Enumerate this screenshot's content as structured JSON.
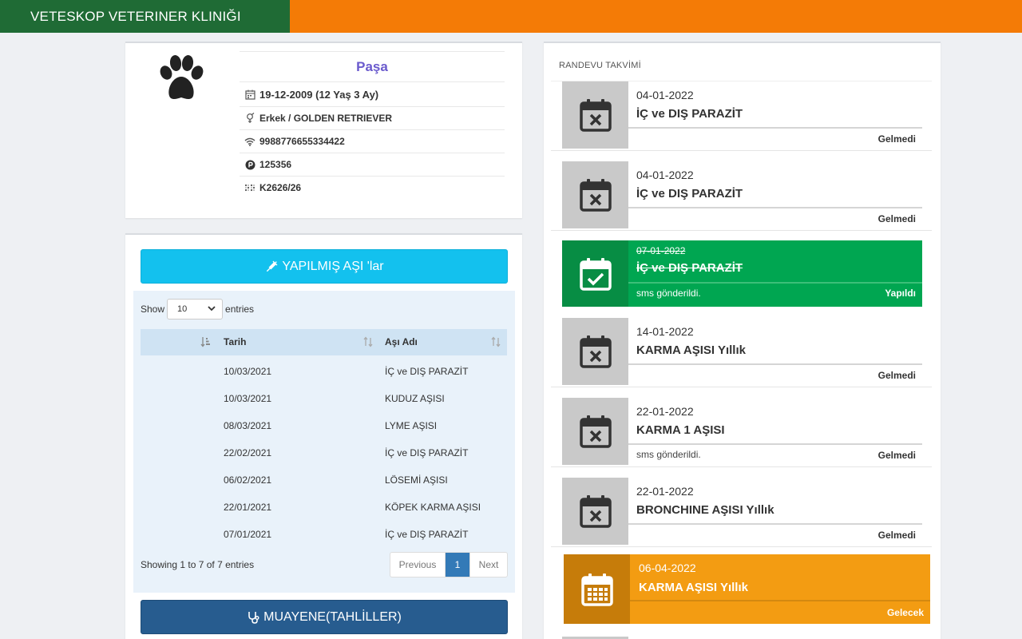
{
  "header": {
    "brand": "VETESKOP VETERINER KLINIĞI",
    "brand_color": "#1f6b35",
    "accent_color": "#f47b06"
  },
  "pet": {
    "avatar_icon": "paw-icon",
    "name": "Paşa",
    "birth": "19-12-2009 (12 Yaş 3 Ay)",
    "sex_breed": "Erkek / GOLDEN RETRIEVER",
    "chip": "9988776655334422",
    "p_no": "125356",
    "kod": "K2626/26"
  },
  "vaccines": {
    "button_label": "YAPILMIŞ AŞI 'lar",
    "show_label": "Show",
    "entries_label": "entries",
    "page_size": "10",
    "columns": [
      "Tarih",
      "Aşı Adı"
    ],
    "rows": [
      {
        "date": "10/03/2021",
        "name": "İÇ ve DIŞ PARAZİT"
      },
      {
        "date": "10/03/2021",
        "name": "KUDUZ AŞISI"
      },
      {
        "date": "08/03/2021",
        "name": "LYME AŞISI"
      },
      {
        "date": "22/02/2021",
        "name": "İÇ ve DIŞ PARAZİT"
      },
      {
        "date": "06/02/2021",
        "name": "LÖSEMİ AŞISI"
      },
      {
        "date": "22/01/2021",
        "name": "KÖPEK KARMA AŞISI"
      },
      {
        "date": "07/01/2021",
        "name": "İÇ ve DIŞ PARAZİT"
      }
    ],
    "info": "Showing 1 to 7 of 7 entries",
    "pager": {
      "prev": "Previous",
      "current": "1",
      "next": "Next"
    },
    "exam_button_label": "MUAYENE(TAHLİLLER)"
  },
  "appointments": {
    "title": "RANDEVU TAKVİMİ",
    "items": [
      {
        "date": "04-01-2022",
        "name": "İÇ ve DIŞ PARAZİT",
        "note": "",
        "status": "Gelmedi",
        "kind": "missed"
      },
      {
        "date": "04-01-2022",
        "name": "İÇ ve DIŞ PARAZİT",
        "note": "",
        "status": "Gelmedi",
        "kind": "missed"
      },
      {
        "date": "07-01-2022",
        "name": "İÇ ve DIŞ PARAZİT",
        "note": "sms gönderildi.",
        "status": "Yapıldı",
        "kind": "done",
        "color": "#00a651"
      },
      {
        "date": "14-01-2022",
        "name": "KARMA AŞISI Yıllık",
        "note": "",
        "status": "Gelmedi",
        "kind": "missed"
      },
      {
        "date": "22-01-2022",
        "name": "KARMA 1 AŞISI",
        "note": "sms gönderildi.",
        "status": "Gelmedi",
        "kind": "missed"
      },
      {
        "date": "22-01-2022",
        "name": "BRONCHINE AŞISI Yıllık",
        "note": "",
        "status": "Gelmedi",
        "kind": "missed"
      },
      {
        "date": "06-04-2022",
        "name": "KARMA AŞISI Yıllık",
        "note": "",
        "status": "Gelecek",
        "kind": "upcoming",
        "color": "#f39c12"
      }
    ]
  }
}
